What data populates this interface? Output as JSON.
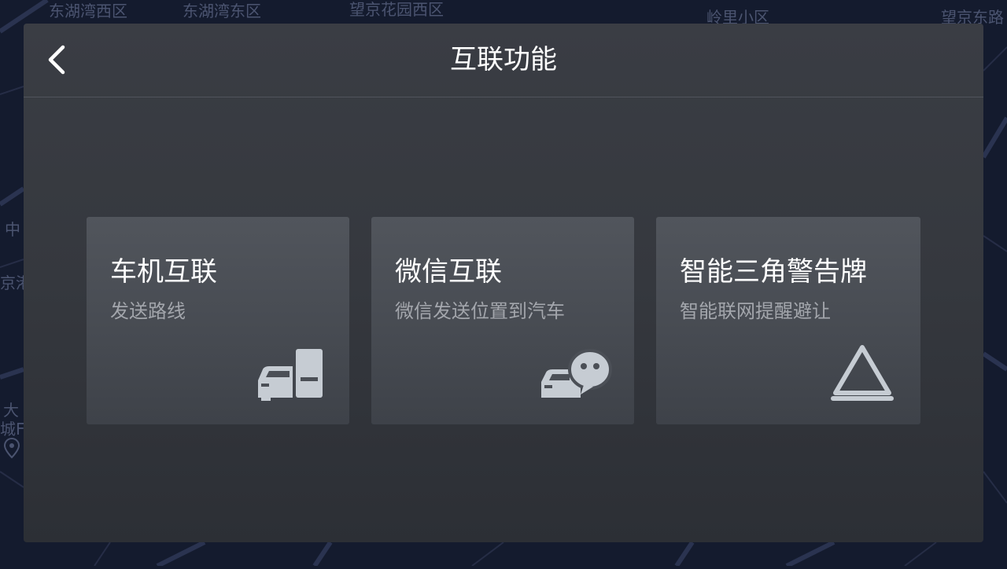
{
  "map": {
    "labels": [
      "东湖湾西区",
      "东湖湾东区",
      "望京花园西区",
      "岭里小区",
      "望京东路",
      "中",
      "京港",
      "大",
      "城F"
    ]
  },
  "header": {
    "title": "互联功能"
  },
  "cards": [
    {
      "title": "车机互联",
      "subtitle": "发送路线",
      "icon": "car-phone-icon"
    },
    {
      "title": "微信互联",
      "subtitle": "微信发送位置到汽车",
      "icon": "car-wechat-icon"
    },
    {
      "title": "智能三角警告牌",
      "subtitle": "智能联网提醒避让",
      "icon": "warning-triangle-icon"
    }
  ],
  "colors": {
    "panel": "#35383e",
    "card": "#4b4f56",
    "icon": "#c6ccd3",
    "map_bg": "#141b2e"
  }
}
